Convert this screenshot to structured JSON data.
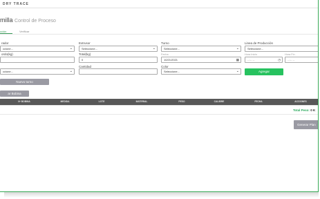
{
  "brand": "DRY TRACE",
  "page": {
    "title": "milla",
    "subtitle": "Control de Proceso"
  },
  "tabs": [
    {
      "label": "cción",
      "active": true
    },
    {
      "label": "Verificar",
      "active": false
    }
  ],
  "form": {
    "operador_label": "rador",
    "operador_value": "ccione...",
    "extrusor_label": "Extrusor",
    "extrusor_value": "Seleccione...",
    "turno_label": "Turno",
    "turno_value": "Seleccione...",
    "linea_label": "Linea de Producción",
    "linea_value": "Seleccione...",
    "gordo_label": "ordo(kg)",
    "total_label": "Total(kg)",
    "total_value": "0",
    "fecha_label": "Fecha",
    "fecha_value": "10/21/2021",
    "hora_inicio_label": "Hora Inicio",
    "hora_inicio_placeholder": "--:-- --",
    "hora_fin_label": "Hora Fin",
    "hora_fin_placeholder": "--:-- --",
    "cantidad_label": "Cantidad",
    "color_label": "Color",
    "color_value": "Seleccione...",
    "row3_select_value": "ccione...",
    "agregar_button": "Agregar",
    "nuevo_turno_button": "Nuevo turno",
    "add_bobina_button": "ar Bobina"
  },
  "table": {
    "headers": [
      "Nº BOBINA",
      "MEDIDA",
      "LOTE",
      "MATERIAL",
      "PESO",
      "CALIBRE",
      "FECHA",
      "ACCIONES"
    ],
    "rows": []
  },
  "summary": {
    "total_label": "Total Peso:",
    "total_value": "0 K"
  },
  "generate_button": "Generar Plan",
  "colors": {
    "accent": "#27c25f",
    "header_bg": "#585858",
    "button_gray": "#9a9aa3"
  }
}
